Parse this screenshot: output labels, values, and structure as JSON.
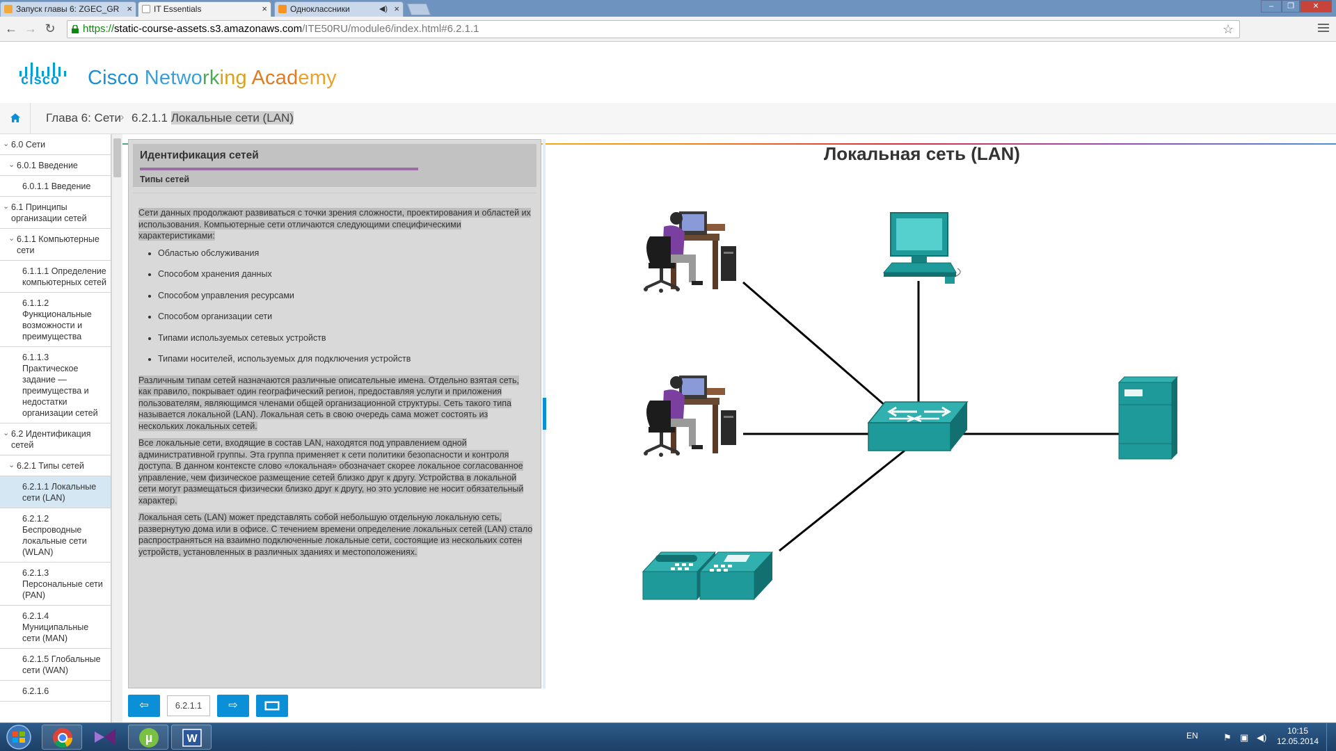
{
  "browser": {
    "tabs": [
      {
        "title": "Запуск главы 6: ZGEC_GR",
        "icon_color": "#f2a93b"
      },
      {
        "title": "IT Essentials",
        "icon_color": "#ffffff"
      },
      {
        "title": "Одноклассники",
        "icon_color": "#f7931e"
      }
    ],
    "url": {
      "scheme": "https://",
      "host": "static-course-assets.s3.amazonaws.com",
      "path": "/ITE50RU/module6/index.html#6.2.1.1"
    }
  },
  "header": {
    "logo_word": "cisco",
    "title_words": [
      {
        "text": "Cisco ",
        "color": "#1a8fd6"
      },
      {
        "text": "Netwo",
        "color": "#3b9fd8"
      },
      {
        "text": "rk",
        "color": "#4daa57"
      },
      {
        "text": "ing ",
        "color": "#d8a21c"
      },
      {
        "text": "Acad",
        "color": "#e07b22"
      },
      {
        "text": "emy",
        "color": "#e7a32b"
      }
    ]
  },
  "breadcrumb": {
    "chapter": "Глава 6: Сети",
    "separator": "›",
    "page_number": "6.2.1.1 ",
    "page_title": "Локальные сети (LAN)"
  },
  "sidebar": {
    "items": [
      {
        "label": "6.0 Сети",
        "level": 0,
        "chevron": "⌄",
        "active": false
      },
      {
        "label": "6.0.1 Введение",
        "level": 1,
        "chevron": "⌄",
        "active": false
      },
      {
        "label": "6.0.1.1 Введение",
        "level": 2,
        "chevron": "",
        "active": false
      },
      {
        "label": "6.1 Принципы организации сетей",
        "level": 0,
        "chevron": "⌄",
        "active": false
      },
      {
        "label": "6.1.1 Компьютерные сети",
        "level": 1,
        "chevron": "⌄",
        "active": false
      },
      {
        "label": "6.1.1.1 Определение компьютерных сетей",
        "level": 2,
        "chevron": "",
        "active": false
      },
      {
        "label": "6.1.1.2 Функциональные возможности и преимущества",
        "level": 2,
        "chevron": "",
        "active": false
      },
      {
        "label": "6.1.1.3 Практическое задание — преимущества и недостатки организации сетей",
        "level": 2,
        "chevron": "",
        "active": false
      },
      {
        "label": "6.2 Идентификация сетей",
        "level": 0,
        "chevron": "⌄",
        "active": false
      },
      {
        "label": "6.2.1 Типы сетей",
        "level": 1,
        "chevron": "⌄",
        "active": false
      },
      {
        "label": "6.2.1.1 Локальные сети (LAN)",
        "level": 2,
        "chevron": "",
        "active": true
      },
      {
        "label": "6.2.1.2 Беспроводные локальные сети (WLAN)",
        "level": 2,
        "chevron": "",
        "active": false
      },
      {
        "label": "6.2.1.3 Персональные сети (PAN)",
        "level": 2,
        "chevron": "",
        "active": false
      },
      {
        "label": "6.2.1.4 Муниципальные сети (MAN)",
        "level": 2,
        "chevron": "",
        "active": false
      },
      {
        "label": "6.2.1.5 Глобальные сети (WAN)",
        "level": 2,
        "chevron": "",
        "active": false
      },
      {
        "label": "6.2.1.6",
        "level": 2,
        "chevron": "",
        "active": false
      }
    ]
  },
  "content": {
    "title": "Идентификация сетей",
    "subtitle": "Типы сетей",
    "intro": "Сети данных продолжают развиваться с точки зрения сложности, проектирования и областей их использования. Компьютерные сети отличаются следующими специфическими характеристиками:",
    "bullets": [
      "Областью обслуживания",
      "Способом хранения данных",
      "Способом управления ресурсами",
      "Способом организации сети",
      "Типами используемых сетевых устройств",
      "Типами носителей, используемых для подключения устройств"
    ],
    "paragraphs": [
      "Различным типам сетей назначаются различные описательные имена. Отдельно взятая сеть, как правило, покрывает один географический регион, предоставляя услуги и приложения пользователям, являющимся членами общей организационной структуры. Сеть такого типа называется локальной (LAN). Локальная сеть в свою очередь сама может состоять из нескольких локальных сетей.",
      "Все локальные сети, входящие в состав LAN, находятся под управлением одной административной группы. Эта группа применяет к сети политики безопасности и контроля доступа. В данном контексте слово «локальная» обозначает скорее локальное согласованное управление, чем физическое размещение сетей близко друг к другу. Устройства в локальной сети могут размещаться физически близко друг к другу, но это условие не носит обязательный характер.",
      "Локальная сеть (LAN) может представлять собой небольшую отдельную локальную сеть, развернутую дома или в офисе. С течением времени определение локальных сетей (LAN) стало распространяться на взаимно подключенные локальные сети, состоящие из нескольких сотен устройств, установленных в различных зданиях и местоположениях."
    ]
  },
  "navigation": {
    "prev_symbol": "⇦",
    "page_field": "6.2.1.1",
    "next_symbol": "⇨"
  },
  "diagram": {
    "title": "Локальная сеть (LAN)",
    "device_color": "#1f9a9a",
    "nodes": [
      "user-workstation-top",
      "desktop-computer",
      "user-workstation-middle",
      "switch",
      "server",
      "ip-phones"
    ]
  },
  "taskbar": {
    "language": "EN",
    "time": "10:15",
    "date": "12.05.2014"
  }
}
